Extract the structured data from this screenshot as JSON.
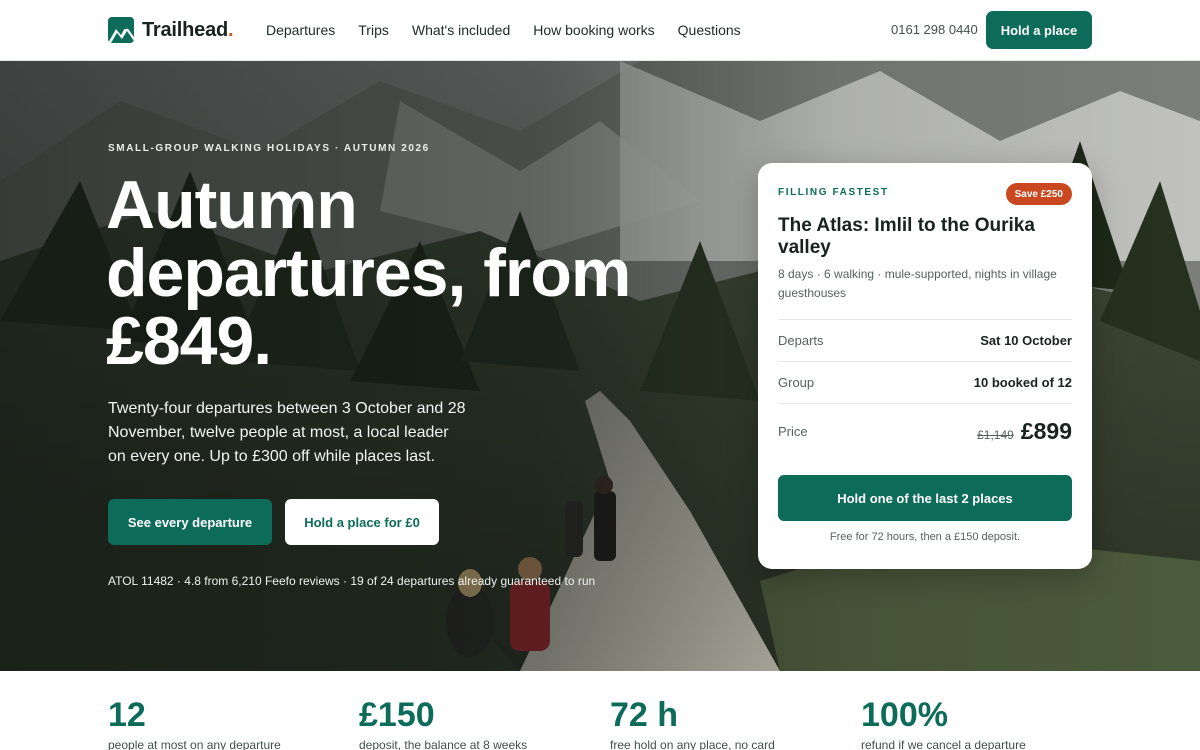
{
  "header": {
    "brand": "Trailhead",
    "brand_dot": ".",
    "nav": [
      "Departures",
      "Trips",
      "What's included",
      "How booking works",
      "Questions"
    ],
    "phone": "0161 298 0440",
    "cta": "Hold a place"
  },
  "hero": {
    "eyebrow": "SMALL-GROUP WALKING HOLIDAYS · AUTUMN 2026",
    "headline": "Autumn departures, from £849.",
    "lede": "Twenty-four departures between 3 October and 28 November, twelve people at most, a local leader on every one. Up to £300 off while places last.",
    "primary_button": "See every departure",
    "secondary_button": "Hold a place for £0",
    "trust_line": "ATOL 11482 · 4.8 from 6,210 Feefo reviews · 19 of 24 departures already guaranteed to run"
  },
  "card": {
    "eyebrow": "FILLING FASTEST",
    "badge": "Save £250",
    "title": "The Atlas: Imlil to the Ourika valley",
    "subtitle": "8 days · 6 walking · mule-supported, nights in village guesthouses",
    "rows": [
      {
        "label": "Departs",
        "value": "Sat 10 October"
      },
      {
        "label": "Group",
        "value": "10 booked of 12"
      }
    ],
    "price_label": "Price",
    "price_old": "£1,149",
    "price_new": "£899",
    "cta": "Hold one of the last 2 places",
    "note": "Free for 72 hours, then a £150 deposit."
  },
  "stats": [
    {
      "value": "12",
      "label": "people at most on any departure"
    },
    {
      "value": "£150",
      "label": "deposit, the balance at 8 weeks"
    },
    {
      "value": "72 h",
      "label": "free hold on any place, no card"
    },
    {
      "value": "100%",
      "label": "refund if we cancel a departure"
    }
  ],
  "colors": {
    "brand_green": "#0d6b5a",
    "accent_orange": "#c9481f",
    "text_dark": "#18221f"
  },
  "icons": [
    "trailhead-logo-icon"
  ]
}
